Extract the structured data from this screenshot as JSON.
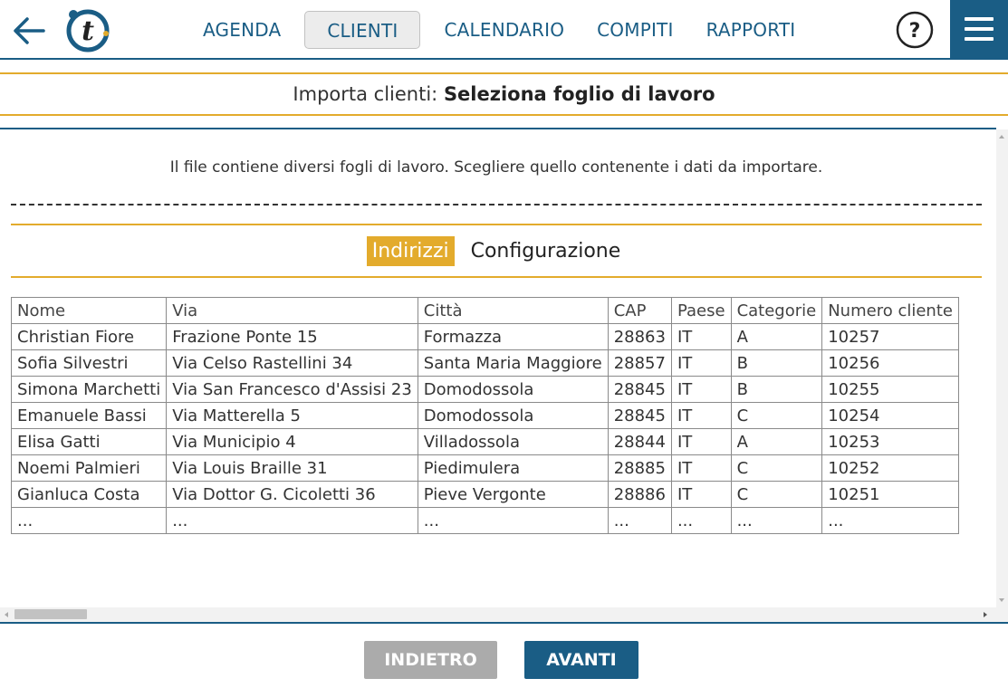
{
  "header": {
    "nav": [
      {
        "label": "AGENDA",
        "active": false
      },
      {
        "label": "CLIENTI",
        "active": true
      },
      {
        "label": "CALENDARIO",
        "active": false
      },
      {
        "label": "COMPITI",
        "active": false
      },
      {
        "label": "RAPPORTI",
        "active": false
      }
    ],
    "help_label": "?",
    "logo_letter": "t",
    "accent_color": "#1a5d85"
  },
  "page": {
    "title_prefix": "Importa clienti: ",
    "title_strong": "Seleziona foglio di lavoro",
    "info_text": "Il file contiene diversi fogli di lavoro. Scegliere quello contenente i dati da importare."
  },
  "sheets": [
    {
      "label": "Indirizzi",
      "active": true
    },
    {
      "label": "Configurazione",
      "active": false
    }
  ],
  "table": {
    "columns": [
      "Nome",
      "Via",
      "Città",
      "CAP",
      "Paese",
      "Categorie",
      "Numero cliente"
    ],
    "rows": [
      [
        "Christian Fiore",
        "Frazione Ponte 15",
        "Formazza",
        "28863",
        "IT",
        "A",
        "10257"
      ],
      [
        "Sofia Silvestri",
        "Via Celso Rastellini 34",
        "Santa Maria Maggiore",
        "28857",
        "IT",
        "B",
        "10256"
      ],
      [
        "Simona Marchetti",
        "Via San Francesco d'Assisi 23",
        "Domodossola",
        "28845",
        "IT",
        "B",
        "10255"
      ],
      [
        "Emanuele Bassi",
        "Via Matterella 5",
        "Domodossola",
        "28845",
        "IT",
        "C",
        "10254"
      ],
      [
        "Elisa Gatti",
        "Via Municipio 4",
        "Villadossola",
        "28844",
        "IT",
        "A",
        "10253"
      ],
      [
        "Noemi Palmieri",
        "Via Louis Braille 31",
        "Piedimulera",
        "28885",
        "IT",
        "C",
        "10252"
      ],
      [
        "Gianluca Costa",
        "Via Dottor G. Cicoletti 36",
        "Pieve Vergonte",
        "28886",
        "IT",
        "C",
        "10251"
      ],
      [
        "...",
        "...",
        "...",
        "...",
        "...",
        "...",
        "..."
      ]
    ]
  },
  "footer": {
    "back_label": "INDIETRO",
    "next_label": "AVANTI"
  }
}
